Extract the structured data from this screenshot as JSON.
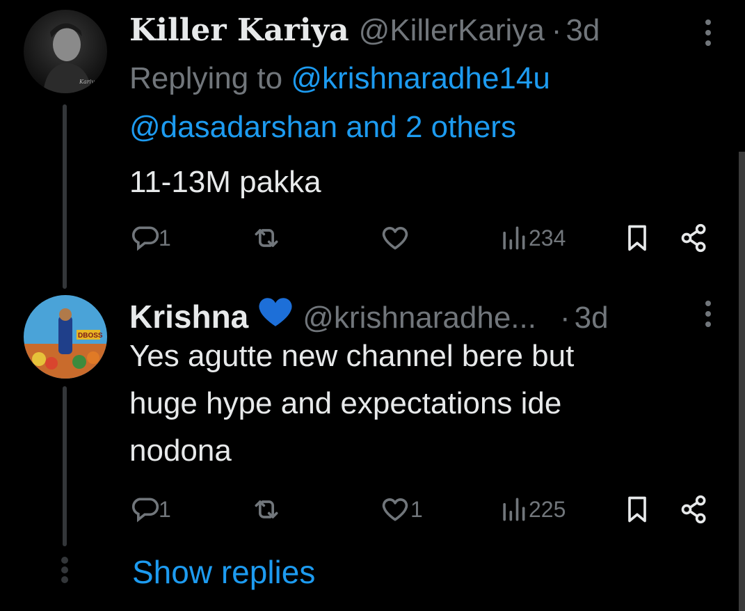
{
  "tweet1": {
    "name": "Killer Kariya",
    "handle": "@KillerKariya",
    "separator": "·",
    "time": "3d",
    "replying_prefix": "Replying to",
    "mention1": "@krishnaradhe14u",
    "mention2": "@dasadarshan",
    "and_others": "and 2 others",
    "text": "11-13M pakka",
    "replies": "1",
    "retweets": "",
    "likes": "",
    "views": "234"
  },
  "tweet2": {
    "name": "Krishna",
    "emoji": "💙",
    "handle": "@krishnaradhe...",
    "separator": "·",
    "time": "3d",
    "text_line1": "Yes agutte new channel bere but",
    "text_line2": "huge hype and expectations ide",
    "text_line3": "nodona",
    "replies": "1",
    "retweets": "",
    "likes": "1",
    "views": "225"
  },
  "show_replies": "Show replies",
  "colors": {
    "background": "#000000",
    "text": "#e7e9ea",
    "muted": "#71767b",
    "link": "#1d9bf0",
    "heart": "#1d6fd8"
  },
  "icons": [
    "reply-icon",
    "retweet-icon",
    "heart-icon",
    "views-icon",
    "bookmark-icon",
    "share-icon",
    "more-icon"
  ]
}
